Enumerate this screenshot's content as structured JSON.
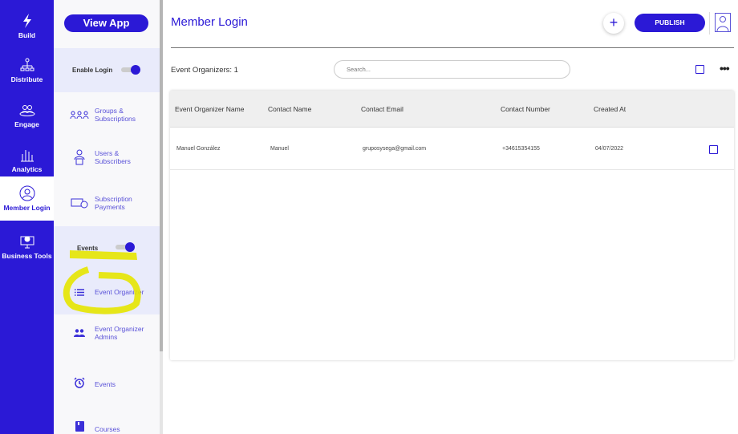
{
  "rail": [
    {
      "label": "Build",
      "icon": "lightning-icon"
    },
    {
      "label": "Distribute",
      "icon": "network-icon"
    },
    {
      "label": "Engage",
      "icon": "people-icon"
    },
    {
      "label": "Analytics",
      "icon": "bar-chart-icon"
    },
    {
      "label": "Member Login",
      "icon": "user-circle-icon",
      "active": true
    },
    {
      "label": "Business Tools",
      "icon": "monitor-dollar-icon"
    }
  ],
  "sidebar": {
    "view_app": "View App",
    "enable_login": "Enable Login",
    "events_toggle": "Events",
    "items": [
      {
        "label": "Groups & Subscriptions"
      },
      {
        "label": "Users & Subscribers"
      },
      {
        "label": "Subscription Payments"
      },
      {
        "label": "Event Organizer"
      },
      {
        "label": "Event Organizer Admins"
      },
      {
        "label": "Events"
      },
      {
        "label": "Courses"
      }
    ]
  },
  "header": {
    "title": "Member Login",
    "add": "+",
    "publish": "PUBLISH"
  },
  "toolbar": {
    "count": "Event Organizers: 1",
    "search_placeholder": "Search..."
  },
  "table": {
    "columns": [
      "Event Organizer Name",
      "Contact Name",
      "Contact Email",
      "Contact Number",
      "Created At"
    ],
    "rows": [
      [
        "Manuel González",
        "Manuel",
        "gruposysega@gmail.com",
        "+34615354155",
        "04/07/2022"
      ]
    ]
  },
  "colors": {
    "brand": "#2b19d6",
    "highlight": "#e6e600"
  }
}
